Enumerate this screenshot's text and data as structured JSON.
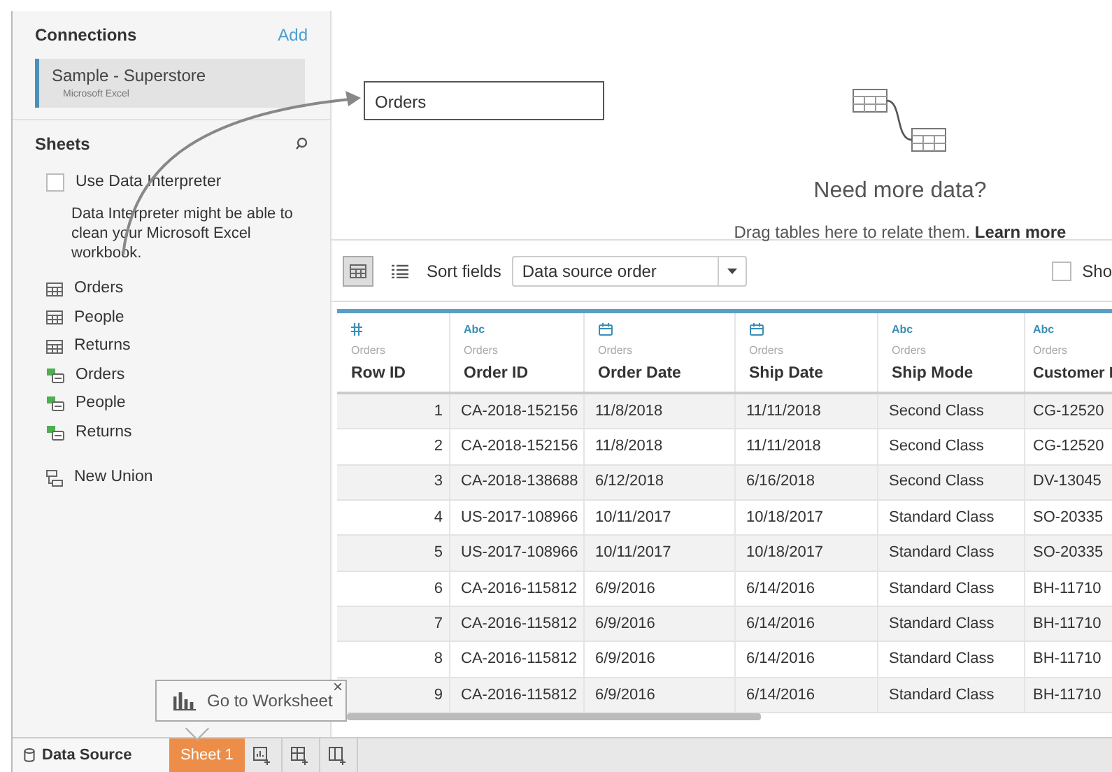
{
  "connections": {
    "title": "Connections",
    "add_link": "Add",
    "items": [
      {
        "name": "Sample - Superstore",
        "type": "Microsoft Excel",
        "selected": true
      }
    ]
  },
  "sheets": {
    "title": "Sheets",
    "data_interpreter": {
      "label": "Use Data Interpreter",
      "checked": false,
      "note": "Data Interpreter might be able to clean your Microsoft Excel workbook."
    },
    "items": [
      {
        "kind": "sheet",
        "label": "Orders"
      },
      {
        "kind": "sheet",
        "label": "People"
      },
      {
        "kind": "sheet",
        "label": "Returns"
      },
      {
        "kind": "named-range",
        "label": "Orders"
      },
      {
        "kind": "named-range",
        "label": "People"
      },
      {
        "kind": "named-range",
        "label": "Returns"
      },
      {
        "kind": "union",
        "label": "New Union"
      }
    ]
  },
  "canvas": {
    "tables": [
      "Orders"
    ],
    "prompt_title": "Need more data?",
    "prompt_text": "Drag tables here to relate them.",
    "learn_more": "Learn more"
  },
  "toolbar": {
    "views": [
      {
        "kind": "grid",
        "selected": true
      },
      {
        "kind": "list",
        "selected": false
      }
    ],
    "sort_label": "Sort fields",
    "sort_value": "Data source order",
    "show_checkbox": {
      "label": "Sho",
      "checked": false
    }
  },
  "grid": {
    "columns": [
      {
        "kind": "number",
        "source": "Orders",
        "name": "Row ID"
      },
      {
        "kind": "string",
        "type_label": "Abc",
        "source": "Orders",
        "name": "Order ID"
      },
      {
        "kind": "date",
        "source": "Orders",
        "name": "Order Date"
      },
      {
        "kind": "date",
        "source": "Orders",
        "name": "Ship Date"
      },
      {
        "kind": "string",
        "type_label": "Abc",
        "source": "Orders",
        "name": "Ship Mode"
      },
      {
        "kind": "string",
        "type_label": "Abc",
        "source": "Orders",
        "name": "Customer I"
      }
    ],
    "rows": [
      [
        "1",
        "CA-2018-152156",
        "11/8/2018",
        "11/11/2018",
        "Second Class",
        "CG-12520"
      ],
      [
        "2",
        "CA-2018-152156",
        "11/8/2018",
        "11/11/2018",
        "Second Class",
        "CG-12520"
      ],
      [
        "3",
        "CA-2018-138688",
        "6/12/2018",
        "6/16/2018",
        "Second Class",
        "DV-13045"
      ],
      [
        "4",
        "US-2017-108966",
        "10/11/2017",
        "10/18/2017",
        "Standard Class",
        "SO-20335"
      ],
      [
        "5",
        "US-2017-108966",
        "10/11/2017",
        "10/18/2017",
        "Standard Class",
        "SO-20335"
      ],
      [
        "6",
        "CA-2016-115812",
        "6/9/2016",
        "6/14/2016",
        "Standard Class",
        "BH-11710"
      ],
      [
        "7",
        "CA-2016-115812",
        "6/9/2016",
        "6/14/2016",
        "Standard Class",
        "BH-11710"
      ],
      [
        "8",
        "CA-2016-115812",
        "6/9/2016",
        "6/14/2016",
        "Standard Class",
        "BH-11710"
      ],
      [
        "9",
        "CA-2016-115812",
        "6/9/2016",
        "6/14/2016",
        "Standard Class",
        "BH-11710"
      ]
    ]
  },
  "tooltip": {
    "text": "Go to Worksheet",
    "close": "×"
  },
  "bottom_tabs": [
    {
      "kind": "data-source",
      "label": "Data Source",
      "selected": true
    },
    {
      "kind": "sheet",
      "label": "Sheet 1",
      "selected": false,
      "highlighted": true
    },
    {
      "kind": "new-worksheet"
    },
    {
      "kind": "new-dashboard"
    },
    {
      "kind": "new-story"
    }
  ]
}
